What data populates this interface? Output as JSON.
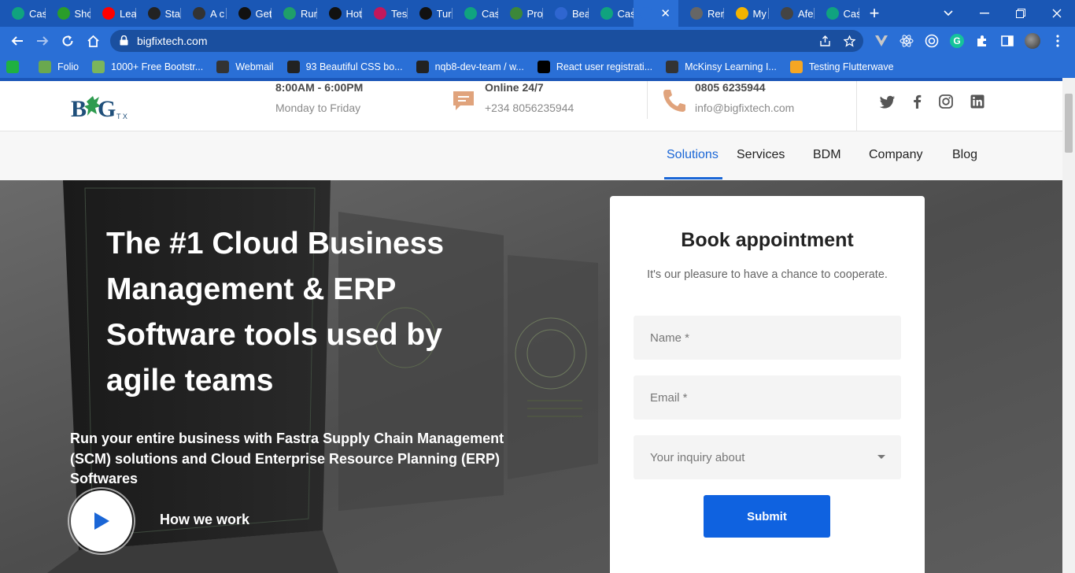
{
  "browser": {
    "tabs": [
      {
        "label": "Cas",
        "icon": "chatgpt-icon",
        "color": "#10a37f"
      },
      {
        "label": "Sho",
        "icon": "hashnode-icon",
        "color": "#2a9d2a"
      },
      {
        "label": "Lea",
        "icon": "youtube-icon",
        "color": "#ff0000"
      },
      {
        "label": "Sta",
        "icon": "stack-icon",
        "color": "#222222"
      },
      {
        "label": "A c",
        "icon": "terminal-icon",
        "color": "#333333"
      },
      {
        "label": "Get",
        "icon": "nextjs-icon",
        "color": "#111111"
      },
      {
        "label": "Run",
        "icon": "react-icon",
        "color": "#1f9f6a"
      },
      {
        "label": "Hot",
        "icon": "nextjs-icon",
        "color": "#111111"
      },
      {
        "label": "Tes",
        "icon": "test-icon",
        "color": "#c2185b"
      },
      {
        "label": "Tur",
        "icon": "turbo-icon",
        "color": "#111111"
      },
      {
        "label": "Cas",
        "icon": "chatgpt-icon",
        "color": "#10a37f"
      },
      {
        "label": "Pro",
        "icon": "node-icon",
        "color": "#3c873a"
      },
      {
        "label": "Bea",
        "icon": "bea-icon",
        "color": "#2f66d0"
      },
      {
        "label": "Cas",
        "icon": "chatgpt-icon",
        "color": "#10a37f"
      },
      {
        "label": "",
        "icon": "bigfix-icon",
        "color": "#2a6fd6",
        "active": true
      },
      {
        "label": "Rer",
        "icon": "layers-icon",
        "color": "#666666"
      },
      {
        "label": "My",
        "icon": "drive-icon",
        "color": "#f4b400"
      },
      {
        "label": "Afe",
        "icon": "globe-icon",
        "color": "#444444"
      },
      {
        "label": "Cas",
        "icon": "chatgpt-icon",
        "color": "#10a37f"
      }
    ],
    "url": "bigfixtech.com",
    "bookmarks": [
      {
        "label": "",
        "icon": "check-icon",
        "color": "#1fb141"
      },
      {
        "label": "Folio",
        "icon": "folio-icon",
        "color": "#6aa84f"
      },
      {
        "label": "1000+ Free Bootstr...",
        "icon": "leaf-icon",
        "color": "#7ab55c"
      },
      {
        "label": "Webmail",
        "icon": "webmail-icon",
        "color": "#333333"
      },
      {
        "label": "93 Beautiful CSS bo...",
        "icon": "css-icon",
        "color": "#222222"
      },
      {
        "label": "nqb8-dev-team / w...",
        "icon": "github-icon",
        "color": "#222222"
      },
      {
        "label": "React user registrati...",
        "icon": "medium-icon",
        "color": "#000000"
      },
      {
        "label": "McKinsy Learning I...",
        "icon": "globe-icon",
        "color": "#333333"
      },
      {
        "label": "Testing Flutterwave",
        "icon": "flutterwave-icon",
        "color": "#f5a623"
      }
    ]
  },
  "site": {
    "header": {
      "hours": "8:00AM - 6:00PM",
      "days": "Monday to Friday",
      "online": "Online 24/7",
      "phone_alt": "+234 8056235944",
      "phone": "0805 6235944",
      "email": "info@bigfixtech.com"
    },
    "nav": [
      "Solutions",
      "Services",
      "BDM",
      "Company",
      "Blog"
    ],
    "hero": {
      "title": "The #1 Cloud Business Management & ERP Software tools used by agile teams",
      "subtitle": "Run your entire business with Fastra Supply Chain Management (SCM) solutions and Cloud Enterprise Resource Planning (ERP) Softwares",
      "video_label": "How we work"
    },
    "form": {
      "title": "Book appointment",
      "subtitle": "It's our pleasure to have a chance to cooperate.",
      "name_placeholder": "Name *",
      "email_placeholder": "Email *",
      "inquiry_placeholder": "Your inquiry about",
      "submit": "Submit"
    }
  }
}
